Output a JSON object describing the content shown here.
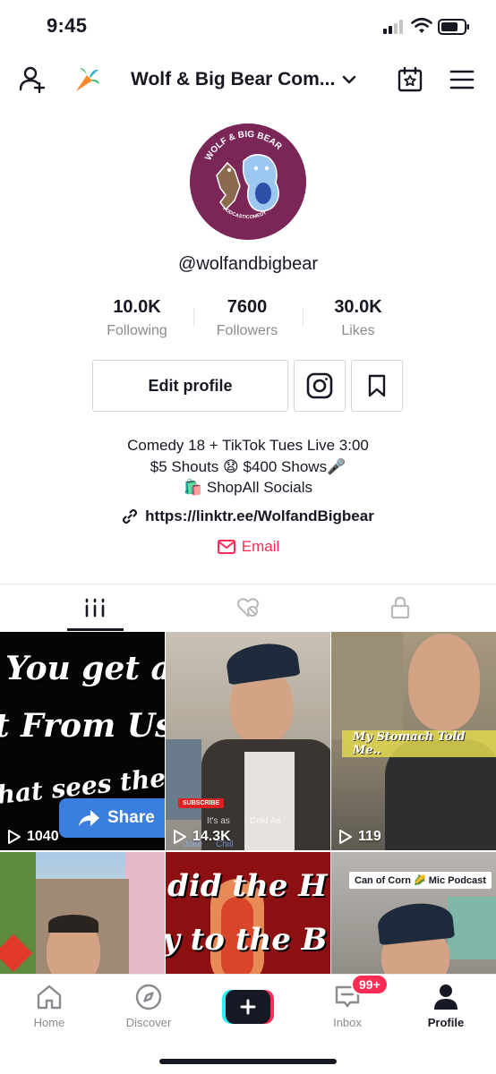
{
  "status_bar": {
    "time": "9:45"
  },
  "header": {
    "title": "Wolf & Big Bear Com...",
    "icons": [
      "add-user-icon",
      "carrot-icon",
      "chevron-down-icon",
      "calendar-star-icon",
      "hamburger-menu-icon"
    ]
  },
  "profile": {
    "username": "@wolfandbigbear",
    "avatar_text_top": "WOLF & BIG BEAR",
    "avatar_text_bottom": "PODCAST/COMEDY",
    "avatar_bg": "#7a2656"
  },
  "stats": [
    {
      "value": "10.0K",
      "label": "Following"
    },
    {
      "value": "7600",
      "label": "Followers"
    },
    {
      "value": "30.0K",
      "label": "Likes"
    }
  ],
  "actions": {
    "edit_label": "Edit profile",
    "icons": [
      "instagram-icon",
      "bookmark-icon"
    ]
  },
  "bio": {
    "line1": "Comedy 18 + TikTok Tues Live 3:00",
    "line2_a": "$5 Shouts",
    "line2_emoji": "😧",
    "line2_b": "$400 Shows",
    "line2_emoji2": "🎤",
    "line3_emoji": "🛍️",
    "line3": "ShopAll Socials",
    "link": "https://linktr.ee/WolfandBigbear",
    "email_label": "Email"
  },
  "tabs": [
    {
      "name": "videos",
      "icon": "grid-icon",
      "active": true
    },
    {
      "name": "liked",
      "icon": "heart-hidden-icon",
      "active": false
    },
    {
      "name": "private",
      "icon": "lock-icon",
      "active": false
    }
  ],
  "videos": [
    {
      "views": "1040",
      "overlay_lines": [
        "You get a",
        "t From Us",
        "hat sees the Vi"
      ],
      "share_label": "Share"
    },
    {
      "views": "14.3K",
      "subscribe_label": "SUBSCRIBE",
      "caption_a": "It's as",
      "caption_b": "Cold As",
      "caption_c": "Joke",
      "caption_d": "Chill"
    },
    {
      "views": "119",
      "overlay_text": "My Stomach Told Me.."
    },
    {
      "views": ""
    },
    {
      "views": "",
      "overlay_lines": [
        "did the H",
        "y to the B"
      ]
    },
    {
      "views": "",
      "label": "Can of Corn 🌽 Mic Podcast"
    }
  ],
  "bottom_nav": [
    {
      "label": "Home",
      "icon": "home-icon"
    },
    {
      "label": "Discover",
      "icon": "compass-icon"
    },
    {
      "label": "",
      "icon": "create-plus-icon"
    },
    {
      "label": "Inbox",
      "icon": "inbox-icon",
      "badge": "99+"
    },
    {
      "label": "Profile",
      "icon": "profile-icon",
      "active": true
    }
  ],
  "colors": {
    "accent": "#fe2c55",
    "cyan": "#25f4ee",
    "text": "#161823",
    "muted": "#8a8b91"
  }
}
